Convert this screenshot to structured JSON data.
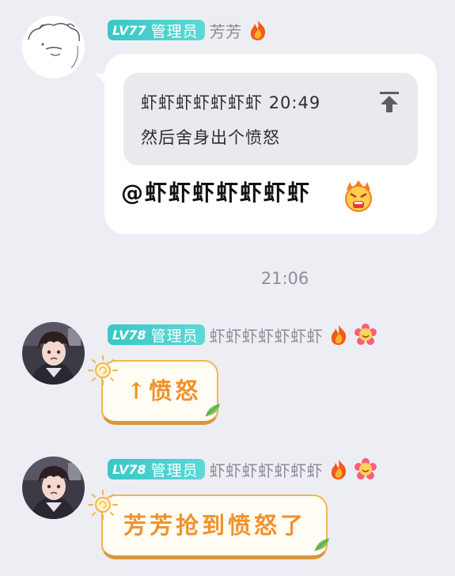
{
  "messages": [
    {
      "level": "LV77",
      "role": "管理员",
      "nickname": "芳芳",
      "reply": {
        "quoted_author": "虾虾虾虾虾虾虾",
        "quoted_time": "20:49",
        "quoted_text": "然后舍身出个愤怒"
      },
      "text": "@虾虾虾虾虾虾虾"
    },
    {
      "level": "LV78",
      "role": "管理员",
      "nickname": "虾虾虾虾虾虾虾",
      "text": "↑愤怒"
    },
    {
      "level": "LV78",
      "role": "管理员",
      "nickname": "虾虾虾虾虾虾虾",
      "text": "芳芳抢到愤怒了"
    }
  ],
  "timestamp": "21:06",
  "colors": {
    "background": "#edeef4",
    "badge": "#37c7c7",
    "bubble_text": "#f0922a",
    "bubble_border": "#f2b552"
  },
  "icons": [
    "fire-icon",
    "flower-icon",
    "jump-to-original-icon",
    "angry-face-emoji",
    "sun-icon",
    "leaf-icon"
  ]
}
